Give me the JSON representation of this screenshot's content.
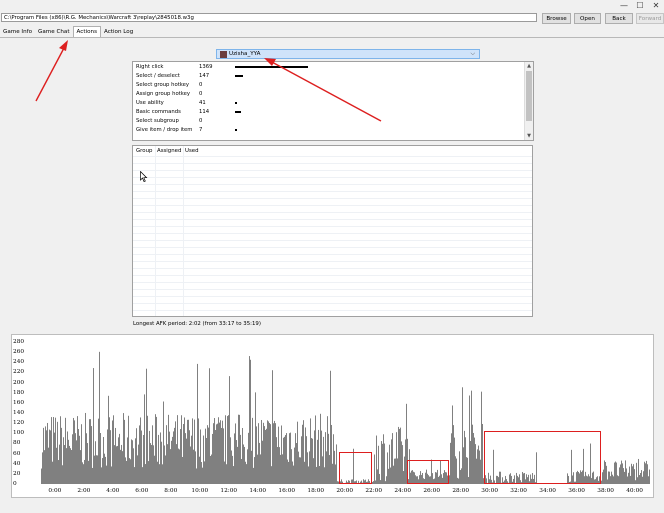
{
  "window": {
    "controls": [
      "—",
      "☐",
      "✕"
    ]
  },
  "toolbar": {
    "path": "C:\\Program Files (x86)\\R.G. Mechanics\\Warcraft 3\\replay\\2845018.w3g",
    "browse": "Browse",
    "open": "Open",
    "back": "Back",
    "forward": "Forward"
  },
  "tabs": [
    {
      "label": "Game Info",
      "active": false
    },
    {
      "label": "Game Chat",
      "active": false
    },
    {
      "label": "Actions",
      "active": true
    },
    {
      "label": "Action Log",
      "active": false
    }
  ],
  "player": {
    "name": "Uzisha_YYA",
    "chevron": "⌵"
  },
  "actions": [
    {
      "label": "Right click",
      "count": "1369",
      "amount": 1369
    },
    {
      "label": "Select / deselect",
      "count": "147",
      "amount": 147
    },
    {
      "label": "Select group hotkey",
      "count": "0",
      "amount": 0
    },
    {
      "label": "Assign group hotkey",
      "count": "0",
      "amount": 0
    },
    {
      "label": "Use ability",
      "count": "41",
      "amount": 41
    },
    {
      "label": "Basic commands",
      "count": "114",
      "amount": 114
    },
    {
      "label": "Select subgroup",
      "count": "0",
      "amount": 0
    },
    {
      "label": "Give item / drop item",
      "count": "7",
      "amount": 7
    }
  ],
  "groups_table": {
    "columns": [
      "Group",
      "Assigned",
      "Used"
    ]
  },
  "afk_text": "Longest AFK period: 2:02 (from 33:17 to 35:19)",
  "chart_data": {
    "type": "bar",
    "yticks": [
      "280",
      "260",
      "240",
      "220",
      "200",
      "180",
      "160",
      "140",
      "120",
      "100",
      "80",
      "60",
      "40",
      "20",
      "0"
    ],
    "ylim": [
      0,
      280
    ],
    "xticks": [
      "0:00",
      "2:00",
      "4:00",
      "6:00",
      "8:00",
      "10:00",
      "12:00",
      "14:00",
      "16:00",
      "18:00",
      "20:00",
      "22:00",
      "24:00",
      "26:00",
      "28:00",
      "30:00",
      "32:00",
      "34:00",
      "36:00",
      "38:00",
      "40:00"
    ],
    "x_minutes_range": [
      -1.3,
      41.2
    ],
    "bar_color": "#808080",
    "highlight_color": "#dd1f1f",
    "highlight_ranges_minutes": [
      [
        19.6,
        21.9
      ],
      [
        24.3,
        27.2
      ],
      [
        29.6,
        37.7
      ]
    ],
    "series_minutes": [
      {
        "start": -1.0,
        "end": 19.4,
        "level": 80,
        "spread": 55,
        "peak": 270
      },
      {
        "start": 19.4,
        "end": 22.0,
        "level": 5,
        "spread": 4,
        "peak": 70
      },
      {
        "start": 22.0,
        "end": 24.3,
        "level": 55,
        "spread": 55,
        "peak": 220
      },
      {
        "start": 24.3,
        "end": 27.2,
        "level": 18,
        "spread": 10,
        "peak": 70
      },
      {
        "start": 27.2,
        "end": 29.6,
        "level": 60,
        "spread": 55,
        "peak": 210
      },
      {
        "start": 29.6,
        "end": 33.2,
        "level": 12,
        "spread": 12,
        "peak": 70
      },
      {
        "start": 33.2,
        "end": 35.3,
        "level": 1,
        "spread": 1,
        "peak": 1
      },
      {
        "start": 35.3,
        "end": 37.7,
        "level": 14,
        "spread": 12,
        "peak": 100
      },
      {
        "start": 37.7,
        "end": 41.0,
        "level": 25,
        "spread": 20,
        "peak": 60
      }
    ]
  }
}
